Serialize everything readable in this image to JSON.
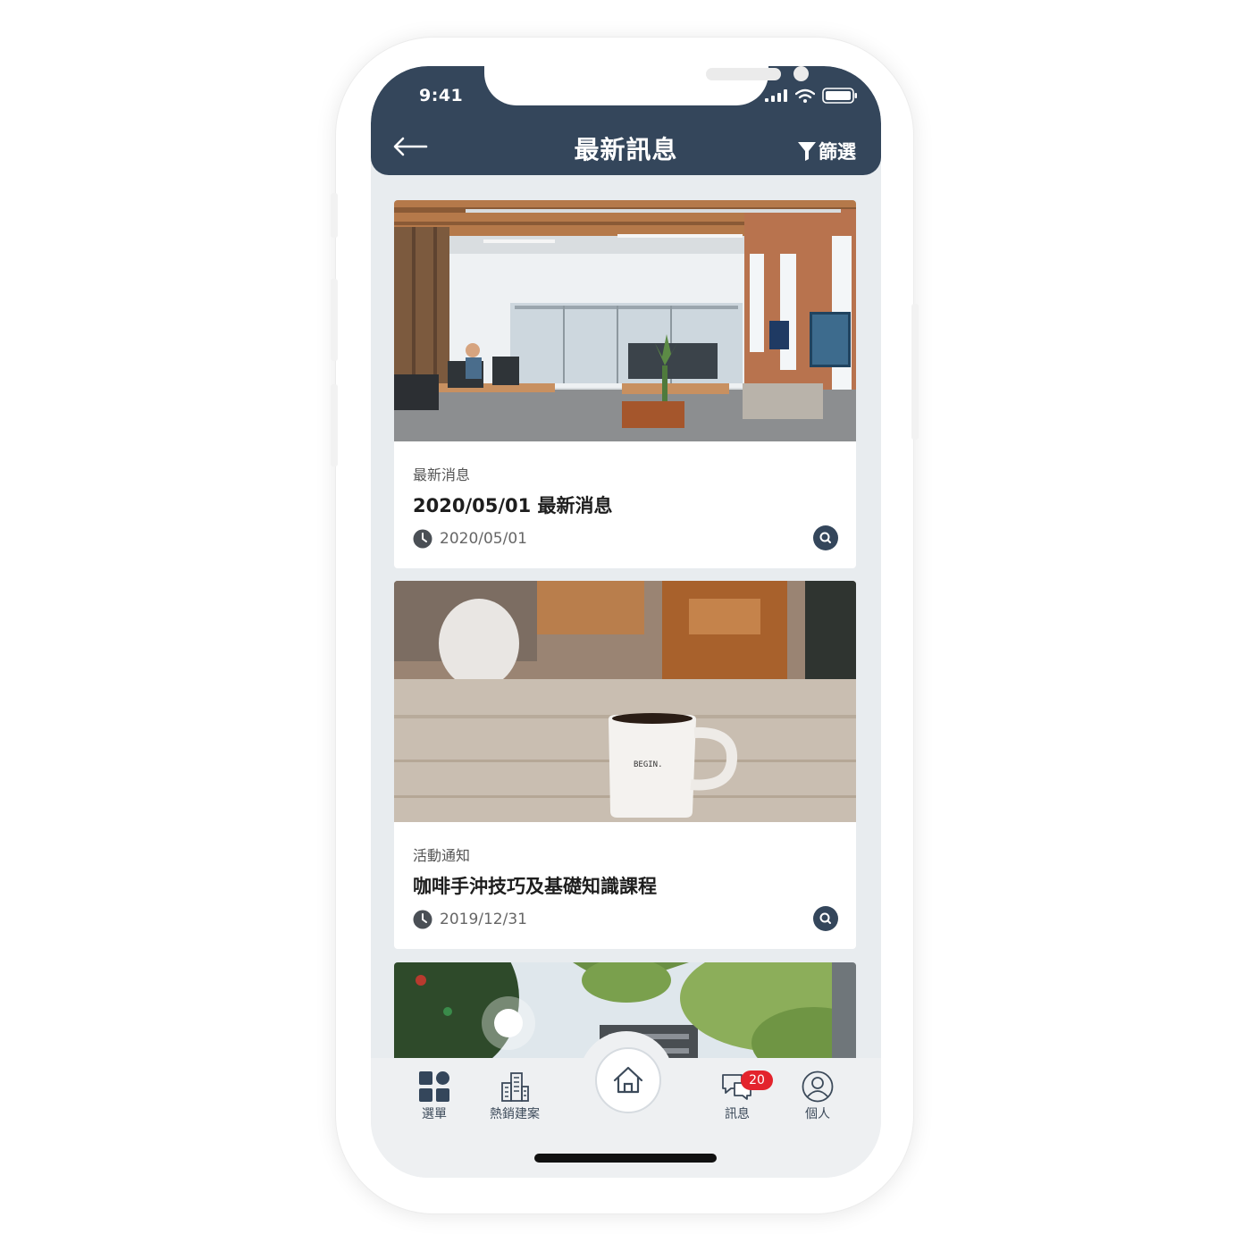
{
  "status_bar": {
    "time": "9:41"
  },
  "header": {
    "title": "最新訊息",
    "filter_label": "篩選"
  },
  "cards": [
    {
      "image": "office-photo",
      "category": "最新消息",
      "title": "2020/05/01 最新消息",
      "date": "2020/05/01"
    },
    {
      "image": "coffee-mug-photo",
      "mug_text": "BEGIN.",
      "category": "活動通知",
      "title": "咖啡手沖技巧及基礎知識課程",
      "date": "2019/12/31"
    },
    {
      "image": "trees-building-photo"
    }
  ],
  "tab_bar": {
    "items": [
      {
        "label": "選單",
        "icon": "grid-icon"
      },
      {
        "label": "熱銷建案",
        "icon": "buildings-icon"
      },
      {
        "label": "",
        "icon": "home-icon"
      },
      {
        "label": "訊息",
        "icon": "chat-icon",
        "badge": "20"
      },
      {
        "label": "個人",
        "icon": "user-icon"
      }
    ]
  },
  "colors": {
    "header_bg": "#34465b",
    "badge": "#e3232c",
    "screen_bg": "#e8ecef"
  }
}
